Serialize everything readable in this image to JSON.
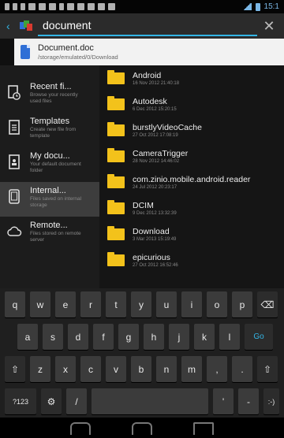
{
  "status_bar": {
    "time": "15:1",
    "icons": [
      "notification-icon",
      "notification-icon",
      "notification-icon",
      "dollar-icon",
      "image-icon",
      "mail-icon",
      "usb-icon",
      "image-icon",
      "app-icon",
      "app-icon",
      "app-icon",
      "app-icon"
    ]
  },
  "search": {
    "query": "document",
    "clear_label": "✕",
    "back_label": "‹"
  },
  "suggestion": {
    "title": "Document.doc",
    "path": "/storage/emulated/0/Download"
  },
  "sidebar": {
    "items": [
      {
        "title": "Recent fi...",
        "subtitle": "Browse your recently used files",
        "icon": "clock-doc-icon"
      },
      {
        "title": "Templates",
        "subtitle": "Create new file from template",
        "icon": "template-icon"
      },
      {
        "title": "My docu...",
        "subtitle": "Your default document folder",
        "icon": "my-documents-icon"
      },
      {
        "title": "Internal...",
        "subtitle": "Files saved on internal storage",
        "icon": "tablet-icon"
      },
      {
        "title": "Remote...",
        "subtitle": "Files stored on remote server",
        "icon": "cloud-icon"
      }
    ]
  },
  "files": [
    {
      "name": "Android",
      "date": "16 Nov 2012 21:40:18"
    },
    {
      "name": "Autodesk",
      "date": "6 Dec 2012 15:20:15"
    },
    {
      "name": "burstlyVideoCache",
      "date": "27 Oct 2012 17:08:19"
    },
    {
      "name": "CameraTrigger",
      "date": "28 Nov 2012 14:46:02"
    },
    {
      "name": "com.zinio.mobile.android.reader",
      "date": "24 Jul 2012 20:23:17"
    },
    {
      "name": "DCIM",
      "date": "9 Dec 2012 13:32:39"
    },
    {
      "name": "Download",
      "date": "3 Mar 2013 15:19:49"
    },
    {
      "name": "epicurious",
      "date": "27 Oct 2012 16:52:46"
    }
  ],
  "keyboard": {
    "row1": [
      "q",
      "w",
      "e",
      "r",
      "t",
      "y",
      "u",
      "i",
      "o",
      "p",
      "⌫"
    ],
    "row2": [
      "a",
      "s",
      "d",
      "f",
      "g",
      "h",
      "j",
      "k",
      "l",
      "Go"
    ],
    "row3": [
      "⇧",
      "z",
      "x",
      "c",
      "v",
      "b",
      "n",
      "m",
      ",",
      ".",
      "⇧"
    ],
    "row4": [
      "?123",
      "⚙",
      "/",
      "",
      "'",
      "-",
      ":-)"
    ]
  },
  "colors": {
    "accent": "#33b5e5",
    "folder": "#f3c21b",
    "background": "#151515"
  }
}
